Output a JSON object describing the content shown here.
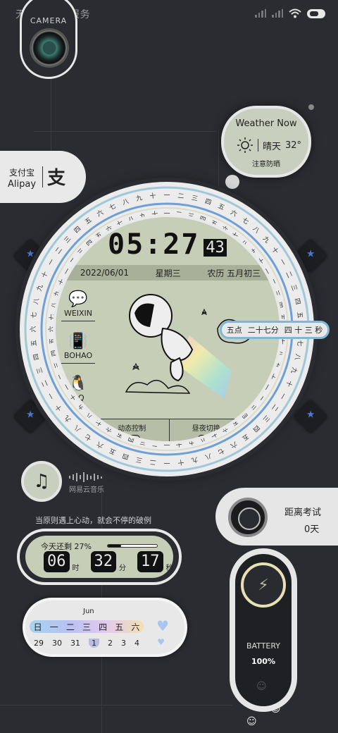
{
  "status": {
    "carrier": "无服务 | 无服务"
  },
  "camera": {
    "label": "CAMERA"
  },
  "weather": {
    "title": "Weather Now",
    "condition": "晴天",
    "temp": "32°",
    "tip": "注意防晒"
  },
  "alipay": {
    "cn": "支付宝",
    "en": "Alipay",
    "logo": "支"
  },
  "dial": {
    "clock": "05:27",
    "seconds": "43",
    "date": "2022/06/01",
    "weekday": "星期三",
    "lunar": "农历 五月初三",
    "apps": [
      {
        "label": "WEIXIN"
      },
      {
        "label": "BOHAO"
      },
      {
        "label": "QQ"
      }
    ],
    "toggles": [
      {
        "label": "动态控制"
      },
      {
        "label": "昼夜切换"
      }
    ],
    "time_tag": {
      "hour": "五点",
      "minute": "二十七分",
      "second": "四 十 三 秒"
    }
  },
  "music": {
    "name": "网易云音乐"
  },
  "exam": {
    "title": "距离考试",
    "days": "0天"
  },
  "quote": "当原则遇上心动，就会不停的破例",
  "countdown": {
    "title": "今天还剩 27%",
    "remaining_fraction": 0.27,
    "hours": "06",
    "hours_unit": "时",
    "minutes": "32",
    "minutes_unit": "分",
    "seconds": "17",
    "seconds_unit": "秒"
  },
  "calendar": {
    "month": "Jun",
    "weekdays": [
      "日",
      "一",
      "二",
      "三",
      "四",
      "五",
      "六"
    ],
    "days": [
      "29",
      "30",
      "31",
      "1",
      "2",
      "3",
      "4"
    ],
    "today_index": 3
  },
  "battery": {
    "label": "BATTERY",
    "percent": "100%"
  }
}
